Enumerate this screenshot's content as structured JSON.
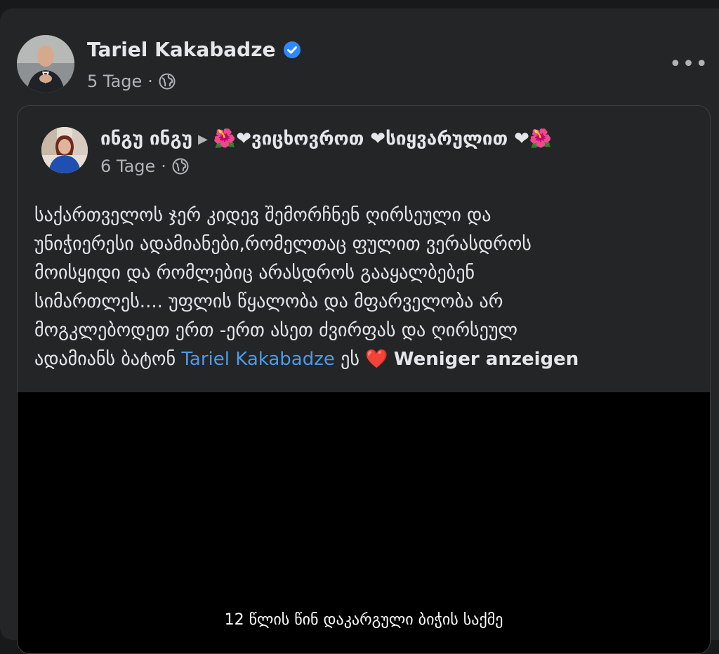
{
  "post": {
    "author": "Tariel Kakabadze",
    "time": "5 Tage",
    "separator": "·",
    "more_label": "•••"
  },
  "shared_post": {
    "author_name": "ინგუ ინგუ",
    "feeling": "🌺❤ვიცხოვროთ ❤სიყვარულით ❤🌺",
    "time": "6 Tage",
    "separator": "·",
    "body_lines": [
      "საქართველოს ჯერ კიდევ შემორჩნენ ღირსეული და",
      "უნიჭიერესი ადამიანები,რომელთაც ფულით ვერასდროს",
      "მოისყიდი და რომლებიც არასდროს გააყალბებენ",
      "სიმართლეს.... უფლის წყალობა და მფარველობა არ",
      "მოგკლებოდეთ ერთ -ერთ ასეთ ძვირფას და ღირსეულ"
    ],
    "last_line_prefix": "ადამიანს ბატონ",
    "mention": "Tariel Kakabadze",
    "last_line_suffix": "ეს",
    "heart": "❤️",
    "see_less": "Weniger anzeigen",
    "video_caption": "12 წლის წინ დაკარგული ბიჭის საქმე"
  },
  "colors": {
    "background": "#18191a",
    "card": "#242526",
    "text": "#e4e6eb",
    "secondary": "#b0b3b8",
    "link": "#4c9be8",
    "verified": "#2d88ff"
  },
  "icons": {
    "verified": "verified-badge-icon",
    "audience": "globe-icon",
    "more": "more-options-icon",
    "arrow": "triangle-right-icon"
  }
}
